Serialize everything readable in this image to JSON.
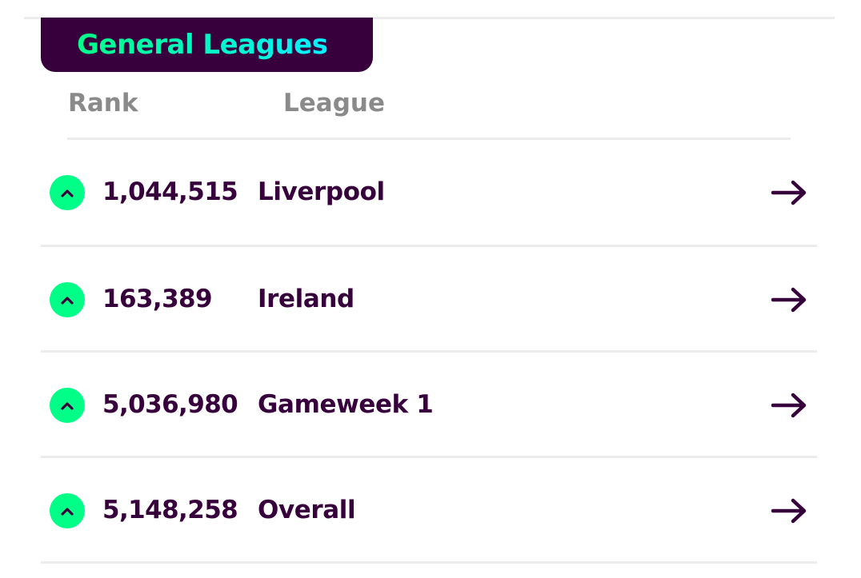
{
  "section": {
    "title": "General Leagues"
  },
  "columns": {
    "rank": "Rank",
    "league": "League"
  },
  "colors": {
    "brand_purple": "#37003c",
    "rank_up_green": "#00ff87",
    "title_cyan": "#05f0ff",
    "header_grey": "#8a8a8a",
    "divider": "#ececec"
  },
  "rows": [
    {
      "movement": "up",
      "movement_icon": "chevron-up-icon",
      "rank": "1,044,515",
      "league": "Liverpool",
      "link_icon": "arrow-right-icon"
    },
    {
      "movement": "up",
      "movement_icon": "chevron-up-icon",
      "rank": "163,389",
      "league": "Ireland",
      "link_icon": "arrow-right-icon"
    },
    {
      "movement": "up",
      "movement_icon": "chevron-up-icon",
      "rank": "5,036,980",
      "league": "Gameweek 1",
      "link_icon": "arrow-right-icon"
    },
    {
      "movement": "up",
      "movement_icon": "chevron-up-icon",
      "rank": "5,148,258",
      "league": "Overall",
      "link_icon": "arrow-right-icon"
    }
  ]
}
